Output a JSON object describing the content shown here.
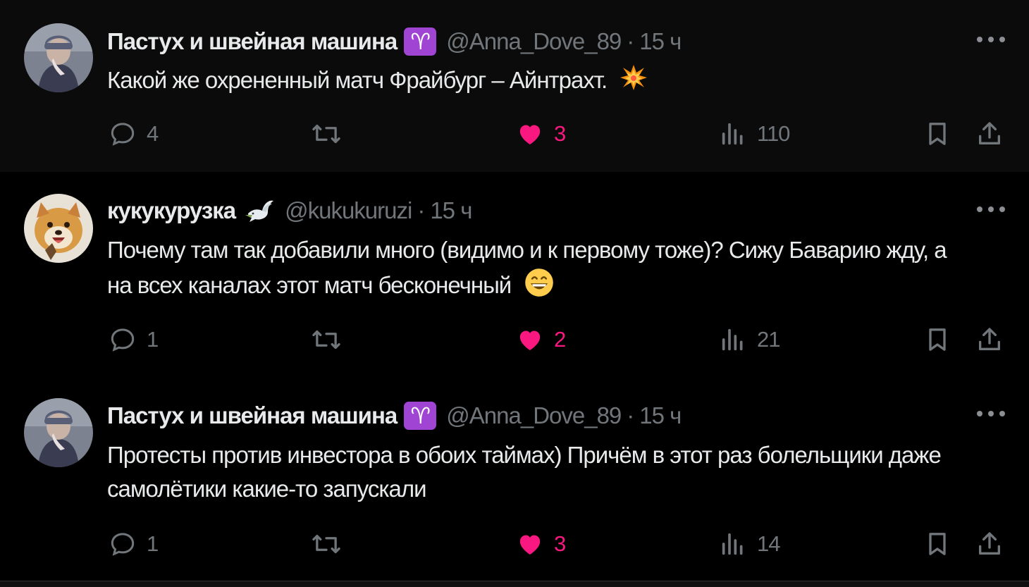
{
  "tweets": [
    {
      "display_name": "Пастух и швейная машина",
      "badge": "♈",
      "handle": "@Anna_Dove_89",
      "separator": "·",
      "time": "15 ч",
      "text": "Какой же охрененный матч Фрайбург – Айнтрахт.",
      "emoji": "collision-emoji",
      "replies": "4",
      "retweets": "",
      "likes": "3",
      "views": "110",
      "liked": true
    },
    {
      "display_name": "кукукурузка",
      "badge": "dove-icon",
      "handle": "@kukukuruzi",
      "separator": "·",
      "time": "15 ч",
      "text": "Почему там так добавили много (видимо и к первому тоже)? Сижу Баварию жду, а на всех каналах этот матч бесконечный",
      "emoji": "grinning-face-emoji",
      "replies": "1",
      "retweets": "",
      "likes": "2",
      "views": "21",
      "liked": true
    },
    {
      "display_name": "Пастух и швейная машина",
      "badge": "♈",
      "handle": "@Anna_Dove_89",
      "separator": "·",
      "time": "15 ч",
      "text": "Протесты против инвестора в обоих таймах) Причём в этот раз болельщики даже самолётики какие-то запускали",
      "emoji": "",
      "replies": "1",
      "retweets": "",
      "likes": "3",
      "views": "14",
      "liked": true
    }
  ],
  "colors": {
    "background": "#000000",
    "highlight_background": "#0b0b0b",
    "text": "#e7e9ea",
    "secondary_text": "#71767b",
    "like": "#f91880",
    "aries_badge": "#9f44d3",
    "thread_line": "#333639"
  }
}
